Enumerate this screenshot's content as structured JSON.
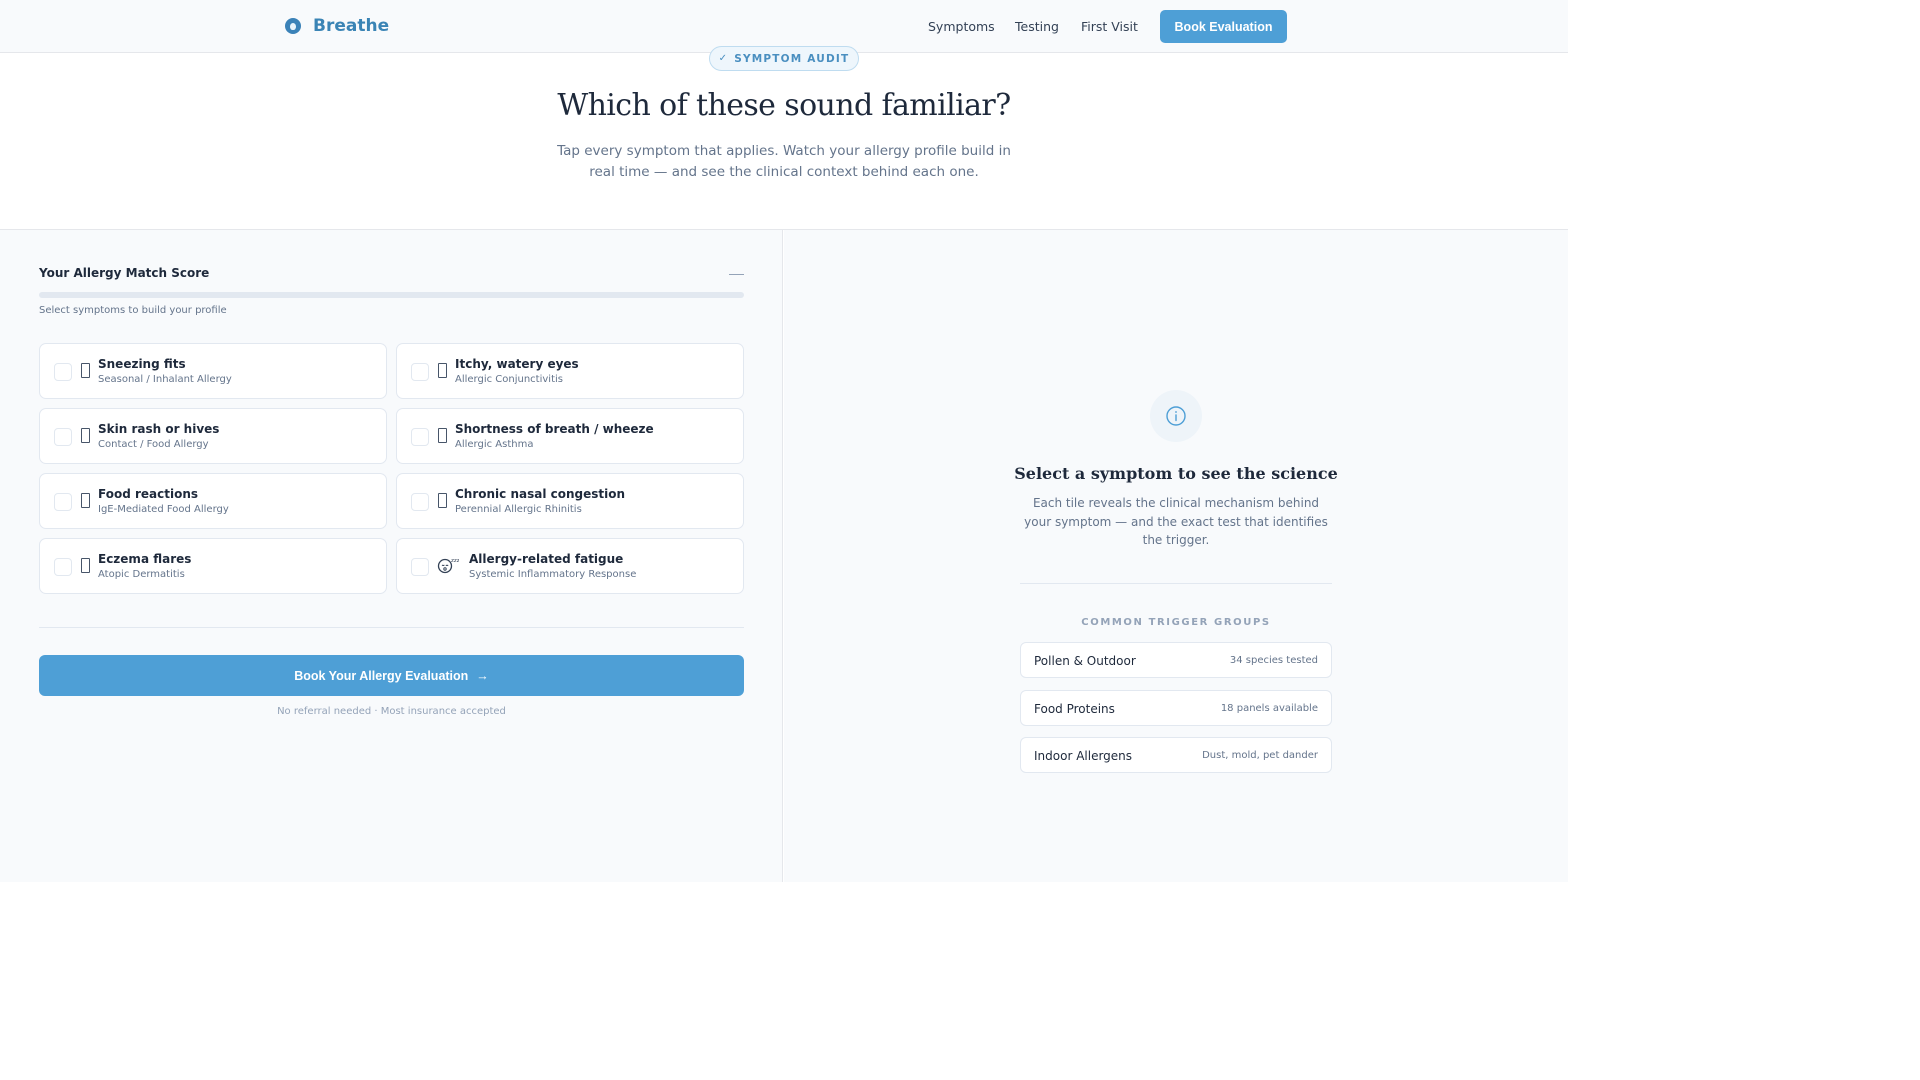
{
  "header": {
    "brand": "Breathe",
    "nav": [
      "Symptoms",
      "Testing",
      "First Visit"
    ],
    "book_label": "Book Evaluation"
  },
  "hero": {
    "badge": "SYMPTOM AUDIT",
    "title": "Which of these sound familiar?",
    "subtitle": "Tap every symptom that applies. Watch your allergy profile build in real time — and see the clinical context behind each one."
  },
  "score": {
    "title": "Your Allergy Match Score",
    "value": "—",
    "progress_fraction": 0,
    "hint": "Select symptoms to build your profile"
  },
  "symptoms": [
    {
      "name": "Sneezing fits",
      "category": "Seasonal / Inhalant Allergy",
      "selected": false
    },
    {
      "name": "Itchy, watery eyes",
      "category": "Allergic Conjunctivitis",
      "selected": false
    },
    {
      "name": "Skin rash or hives",
      "category": "Contact / Food Allergy",
      "selected": false
    },
    {
      "name": "Shortness of breath / wheeze",
      "category": "Allergic Asthma",
      "selected": false
    },
    {
      "name": "Food reactions",
      "category": "IgE-Mediated Food Allergy",
      "selected": false
    },
    {
      "name": "Chronic nasal congestion",
      "category": "Perennial Allergic Rhinitis",
      "selected": false
    },
    {
      "name": "Eczema flares",
      "category": "Atopic Dermatitis",
      "selected": false
    },
    {
      "name": "Allergy-related fatigue",
      "category": "Systemic Inflammatory Response",
      "selected": false,
      "icon": "😴"
    }
  ],
  "cta": {
    "label": "Book Your Allergy Evaluation",
    "arrow": "→",
    "note": "No referral needed · Most insurance accepted"
  },
  "science": {
    "title": "Select a symptom to see the science",
    "body": "Each tile reveals the clinical mechanism behind your symptom — and the exact test that identifies the trigger."
  },
  "trigger_groups": {
    "title": "COMMON TRIGGER GROUPS",
    "items": [
      {
        "name": "Pollen & Outdoor",
        "detail": "34 species tested"
      },
      {
        "name": "Food Proteins",
        "detail": "18 panels available"
      },
      {
        "name": "Indoor Allergens",
        "detail": "Dust, mold, pet dander"
      }
    ]
  },
  "colors": {
    "accent": "#4e9fd6",
    "brand": "#3a84b5",
    "text": "#1e293b",
    "muted": "#64748b"
  }
}
